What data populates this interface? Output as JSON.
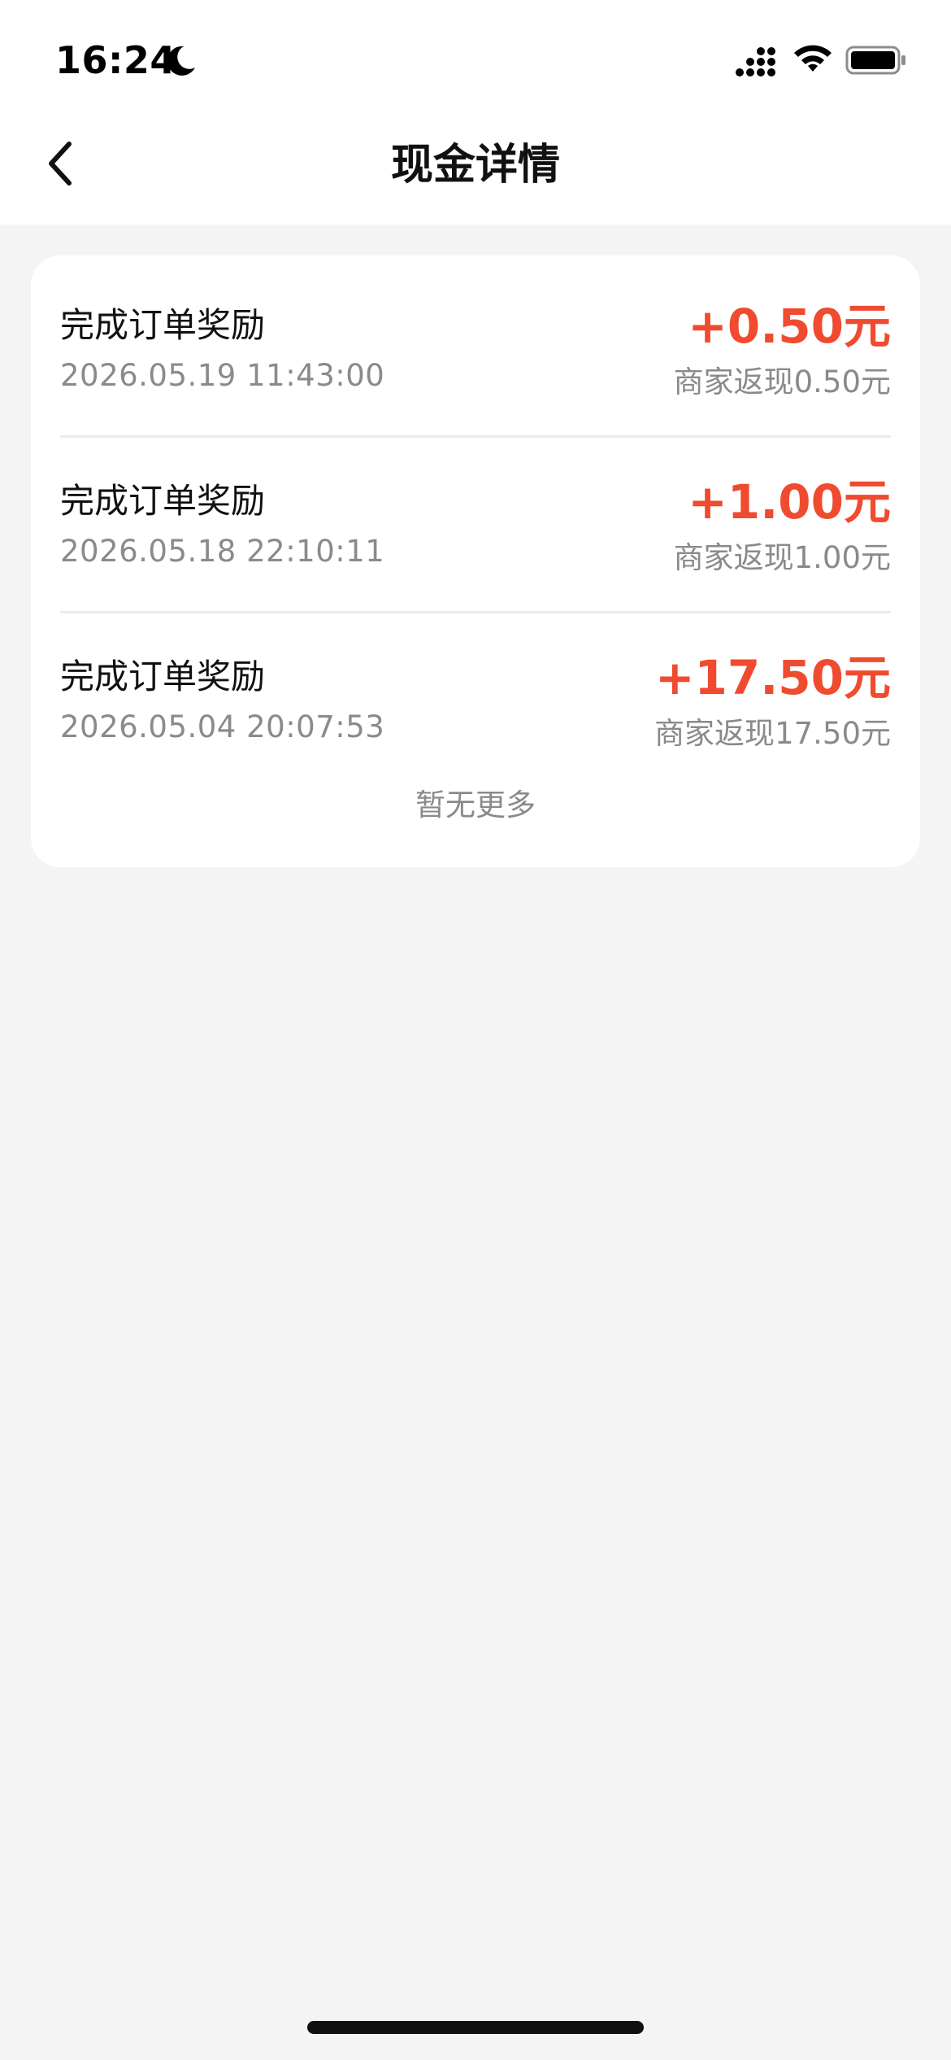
{
  "status_bar": {
    "time": "16:24",
    "icons": [
      "moon-icon",
      "signal-icon",
      "wifi-icon",
      "battery-icon"
    ]
  },
  "nav": {
    "title": "现金详情",
    "back_icon": "chevron-left-icon"
  },
  "records": [
    {
      "title": "完成订单奖励",
      "time": "2026.05.19 11:43:00",
      "amount": "+0.50元",
      "note": "商家返现0.50元"
    },
    {
      "title": "完成订单奖励",
      "time": "2026.05.18 22:10:11",
      "amount": "+1.00元",
      "note": "商家返现1.00元"
    },
    {
      "title": "完成订单奖励",
      "time": "2026.05.04 20:07:53",
      "amount": "+17.50元",
      "note": "商家返现17.50元"
    }
  ],
  "footer_text": "暂无更多",
  "colors": {
    "amount": "#f04a2f",
    "secondary_text": "#8a8a8a",
    "background": "#f4f4f4"
  }
}
